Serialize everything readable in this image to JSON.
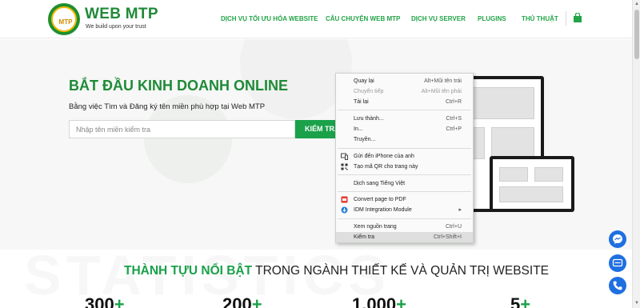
{
  "header": {
    "logo_badge_text": "MTP",
    "logo_title": "WEB MTP",
    "logo_tagline": "We build upon your trust",
    "nav": [
      {
        "label": "DỊCH VỤ TỐI ƯU HÓA WEBSITE"
      },
      {
        "label": "CÂU CHUYỆN WEB MTP"
      },
      {
        "label": "DỊCH VỤ SERVER"
      },
      {
        "label": "PLUGINS"
      },
      {
        "label": "THỦ THUẬT"
      }
    ],
    "cart_icon": "shopping-bag-icon"
  },
  "hero": {
    "title": "BẮT ĐẦU KINH DOANH ONLINE",
    "subtitle": "Bằng việc Tìm và Đăng ký tên miền phù hợp tại Web MTP",
    "search_placeholder": "Nhập tên miền kiểm tra",
    "search_value": "",
    "check_button": "KIỂM TRA"
  },
  "context_menu": {
    "items": [
      {
        "label": "Quay lại",
        "shortcut": "Alt+Mũi tên trái",
        "disabled": false
      },
      {
        "label": "Chuyển tiếp",
        "shortcut": "Alt+Mũi tên phải",
        "disabled": true
      },
      {
        "label": "Tải lại",
        "shortcut": "Ctrl+R",
        "disabled": false
      },
      {
        "label": "Lưu thành...",
        "shortcut": "Ctrl+S",
        "disabled": false
      },
      {
        "label": "In...",
        "shortcut": "Ctrl+P",
        "disabled": false
      },
      {
        "label": "Truyền...",
        "shortcut": "",
        "disabled": false
      },
      {
        "label": "Gửi đến iPhone của anh",
        "shortcut": "",
        "icon": "device-send-icon"
      },
      {
        "label": "Tạo mã QR cho trang này",
        "shortcut": "",
        "icon": "qr-code-icon"
      },
      {
        "label": "Dịch sang Tiếng Việt",
        "shortcut": ""
      },
      {
        "label": "Convert page to PDF",
        "shortcut": "",
        "icon": "pdf-convert-icon"
      },
      {
        "label": "IDM Integration Module",
        "shortcut": "▸",
        "icon": "idm-icon"
      },
      {
        "label": "Xem nguồn trang",
        "shortcut": "Ctrl+U"
      },
      {
        "label": "Kiểm tra",
        "shortcut": "Ctrl+Shift+I",
        "highlighted": true
      }
    ]
  },
  "stats": {
    "title_highlight": "THÀNH TỰU NỔI BẬT",
    "title_rest": " TRONG NGÀNH THIẾT KẾ VÀ QUẢN TRỊ WEBSITE",
    "background_word": "STATISTICS",
    "items": [
      {
        "value": "300",
        "suffix": "+"
      },
      {
        "value": "200",
        "suffix": "+"
      },
      {
        "value": "1.000",
        "suffix": "+"
      },
      {
        "value": "5",
        "suffix": "+"
      }
    ]
  },
  "floating": {
    "buttons": [
      "messenger-icon",
      "chat-icon",
      "phone-icon"
    ]
  },
  "colors": {
    "brand_green": "#1f8a38",
    "accent_green": "#1aa14a",
    "fab_blue": "#1f6fe0"
  }
}
